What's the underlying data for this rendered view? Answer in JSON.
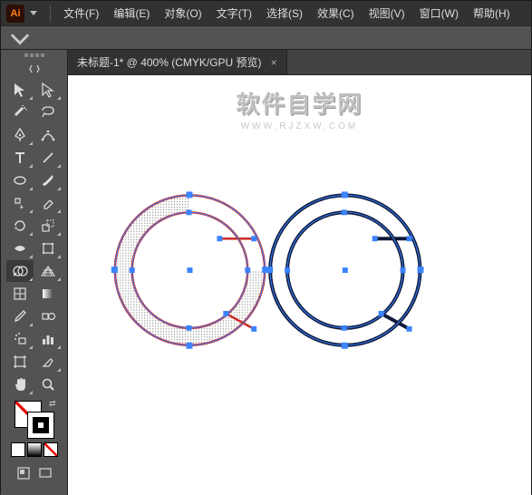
{
  "app": {
    "logo_text": "Ai"
  },
  "menu": {
    "items": [
      "文件(F)",
      "编辑(E)",
      "对象(O)",
      "文字(T)",
      "选择(S)",
      "效果(C)",
      "视图(V)",
      "窗口(W)",
      "帮助(H)"
    ]
  },
  "tabs": [
    {
      "label": "未标题-1* @ 400% (CMYK/GPU 预览)",
      "close": "×"
    }
  ],
  "watermark": {
    "title": "软件自学网",
    "subtitle": "WWW.RJZXW.COM"
  },
  "colors": {
    "ui_dark": "#323232",
    "ui_mid": "#535353",
    "accent": "#ff7f18",
    "selection": "#3b84ff",
    "stroke_red": "#cc2b24",
    "stroke_navy": "#0f1a3a"
  },
  "tools": [
    {
      "name": "selection-tool"
    },
    {
      "name": "direct-selection-tool"
    },
    {
      "name": "magic-wand-tool"
    },
    {
      "name": "lasso-tool"
    },
    {
      "name": "pen-tool"
    },
    {
      "name": "curvature-tool"
    },
    {
      "name": "type-tool"
    },
    {
      "name": "line-segment-tool"
    },
    {
      "name": "rectangle-tool"
    },
    {
      "name": "brush-tool"
    },
    {
      "name": "shaper-tool"
    },
    {
      "name": "eraser-tool"
    },
    {
      "name": "rotate-tool"
    },
    {
      "name": "scale-tool"
    },
    {
      "name": "width-tool"
    },
    {
      "name": "free-transform-tool"
    },
    {
      "name": "shape-builder-tool"
    },
    {
      "name": "perspective-grid-tool"
    },
    {
      "name": "mesh-tool"
    },
    {
      "name": "gradient-tool"
    },
    {
      "name": "eyedropper-tool"
    },
    {
      "name": "blend-tool"
    },
    {
      "name": "symbol-sprayer-tool"
    },
    {
      "name": "column-graph-tool"
    },
    {
      "name": "artboard-tool"
    },
    {
      "name": "slice-tool"
    },
    {
      "name": "hand-tool"
    },
    {
      "name": "zoom-tool"
    }
  ]
}
